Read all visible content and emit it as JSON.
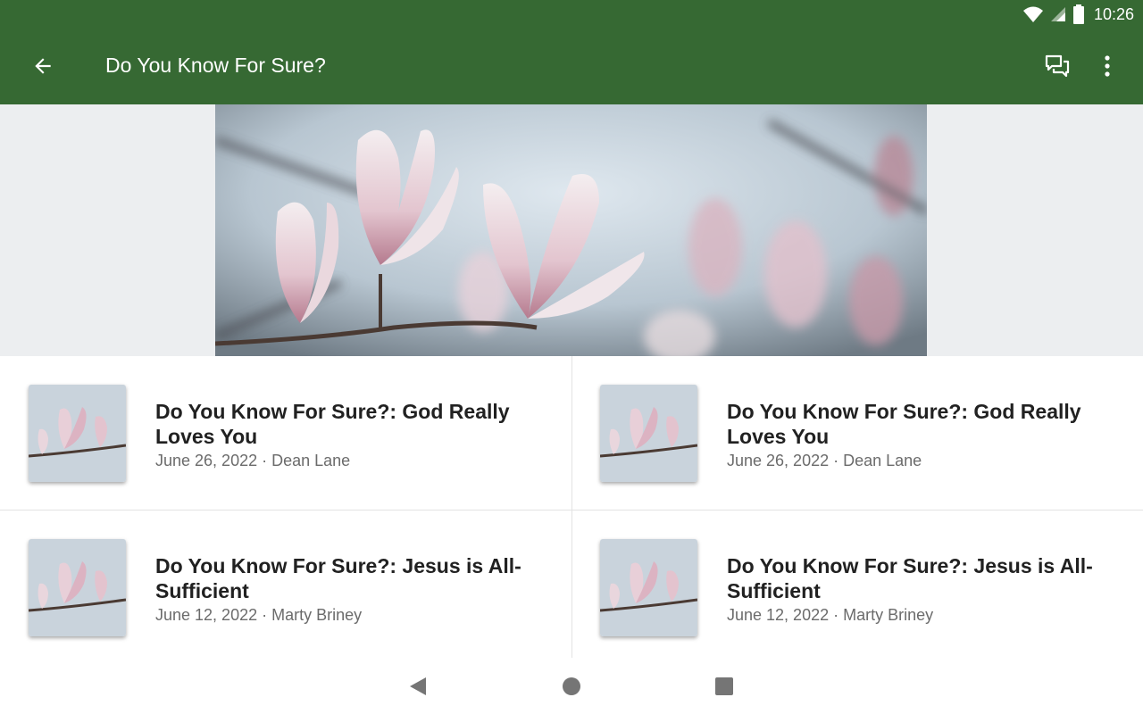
{
  "status_bar": {
    "time": "10:26",
    "icons": [
      "wifi-icon",
      "cell-signal-icon",
      "battery-icon"
    ]
  },
  "app_bar": {
    "title": "Do You Know For Sure?",
    "icons": [
      "back-arrow-icon",
      "chat-icon",
      "more-vert-icon"
    ]
  },
  "colors": {
    "app_bar": "#366933",
    "hero_background": "#eceef0",
    "title_text": "#212121",
    "meta_text": "#6b6b6b"
  },
  "items": [
    {
      "title": "Do You Know For Sure?: God Really Loves You",
      "meta": "June 26, 2022 · Dean Lane"
    },
    {
      "title": "Do You Know For Sure?: God Really Loves You",
      "meta": "June 26, 2022 · Dean Lane"
    },
    {
      "title": "Do You Know For Sure?: Jesus is All-Sufficient",
      "meta": "June 12, 2022 · Marty Briney"
    },
    {
      "title": "Do You Know For Sure?: Jesus is All-Sufficient",
      "meta": "June 12, 2022 · Marty Briney"
    }
  ],
  "nav_bar": {
    "icons": [
      "back-triangle-icon",
      "home-circle-icon",
      "recents-square-icon"
    ]
  }
}
